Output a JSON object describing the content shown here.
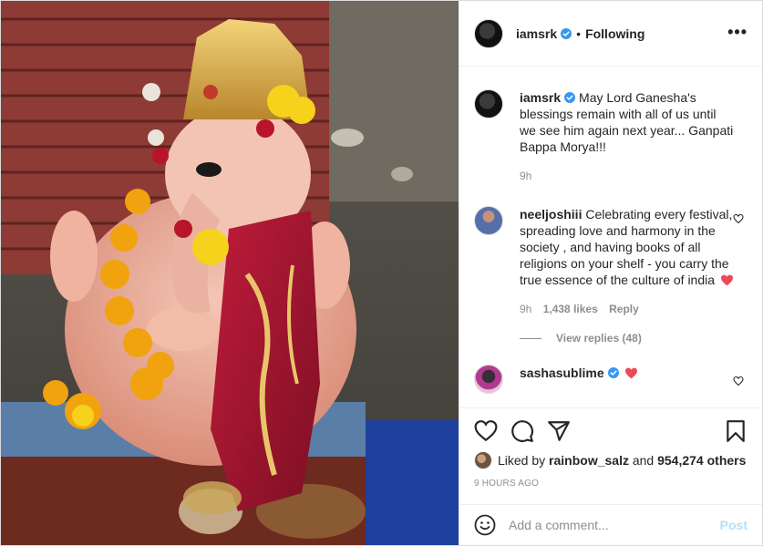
{
  "colors": {
    "verified_blue": "#3897f0",
    "red_heart": "#ed4956",
    "post_disabled": "#b2dffc",
    "muted_text": "#8e8e8e"
  },
  "header": {
    "username": "iamsrk",
    "separator": "•",
    "follow_status": "Following",
    "more_icon": "more-icon"
  },
  "caption": {
    "username": "iamsrk",
    "text": "May Lord Ganesha's blessings remain with all of us until we see him again next year... Ganpati Bappa Morya!!!",
    "age": "9h"
  },
  "comments": [
    {
      "username": "neeljoshiii",
      "text": "Celebrating every festival, spreading love and harmony in the society , and having books of all religions on your shelf - you carry the true essence of the culture of india",
      "age": "9h",
      "likes": "1,438 likes",
      "reply_label": "Reply",
      "view_replies": "View replies (48)"
    },
    {
      "username": "sashasublime"
    }
  ],
  "actions": {
    "like_icon": "heart-icon",
    "comment_icon": "comment-icon",
    "share_icon": "share-icon",
    "save_icon": "bookmark-icon"
  },
  "likes": {
    "prefix": "Liked by",
    "user": "rainbow_salz",
    "and": "and",
    "others": "954,274 others"
  },
  "posted": "9 HOURS AGO",
  "add_comment": {
    "placeholder": "Add a comment...",
    "post_label": "Post"
  }
}
